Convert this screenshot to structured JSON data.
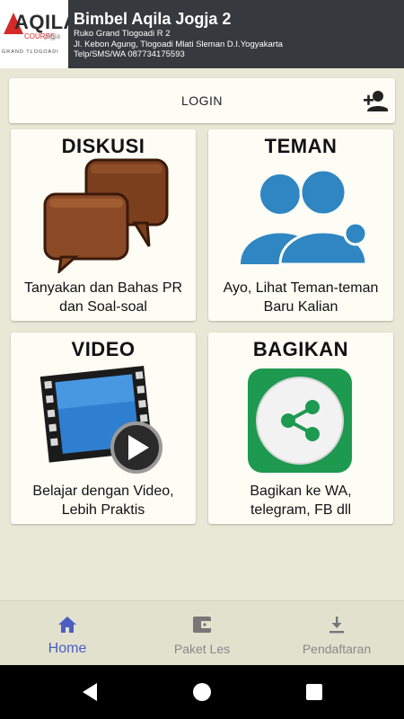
{
  "header": {
    "logo_text": "AQILA",
    "logo_course": "COURSE",
    "logo_city": "jogja",
    "logo_branch": "GRAND TLOGOADI",
    "title": "Bimbel Aqila Jogja 2",
    "address_1": "Ruko Grand Tlogoadi R 2",
    "address_2": "Jl. Kebon Agung, Tlogoadi Mlati Sleman D.I.Yogyakarta",
    "phone": "Telp/SMS/WA 087734175593"
  },
  "login": {
    "label": "LOGIN",
    "icon": "person-add-icon"
  },
  "cards": [
    {
      "title": "DISKUSI",
      "line1": "Tanyakan dan Bahas PR",
      "line2": "dan Soal-soal",
      "icon": "chat-bubbles-icon",
      "color": "#8b4a25"
    },
    {
      "title": "TEMAN",
      "line1": "Ayo, Lihat Teman-teman",
      "line2": "Baru Kalian",
      "icon": "friends-icon",
      "color": "#2f86c2"
    },
    {
      "title": "VIDEO",
      "line1": "Belajar dengan Video,",
      "line2": "Lebih Praktis",
      "icon": "film-play-icon",
      "color": "#2f7fd0"
    },
    {
      "title": "BAGIKAN",
      "line1": "Bagikan ke WA,",
      "line2": "telegram, FB dll",
      "icon": "share-icon",
      "color": "#1e9950"
    }
  ],
  "bottom_nav": [
    {
      "label": "Home",
      "icon": "home-icon",
      "active": true
    },
    {
      "label": "Paket Les",
      "icon": "wallet-icon",
      "active": false
    },
    {
      "label": "Pendaftaran",
      "icon": "download-icon",
      "active": false
    }
  ],
  "colors": {
    "header_bg": "#36393d",
    "page_bg": "#e9e8d6",
    "active_nav": "#4a5fc1",
    "inactive_nav": "#888888"
  }
}
